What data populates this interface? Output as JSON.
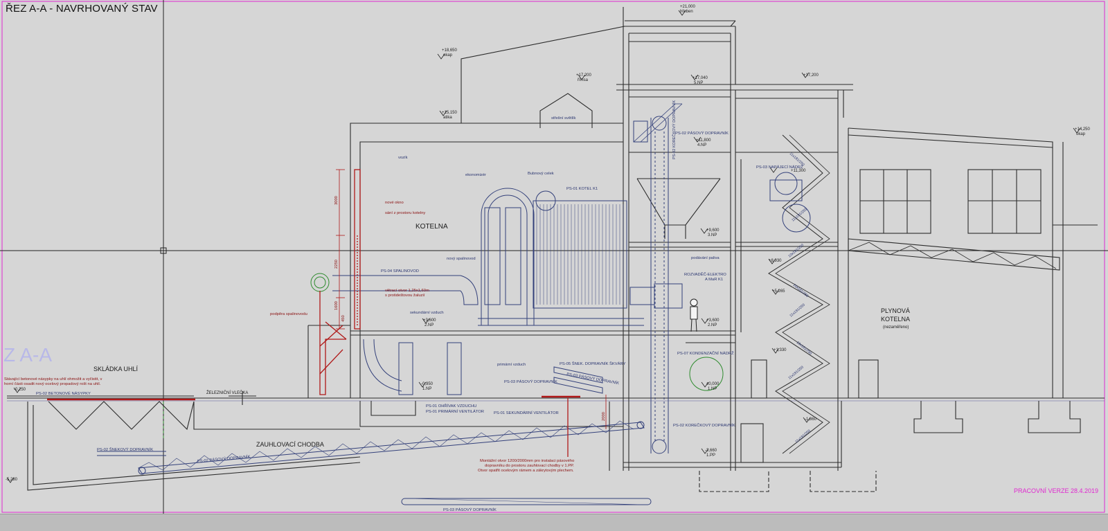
{
  "title": "ŘEZ A-A - NAVRHOVANÝ STAV",
  "version_stamp": "PRACOVNÍ VERZE    28.4.2019",
  "colors": {
    "paper": "#d6d6d6",
    "structure": "#2b2b2b",
    "equipment": "#33407a",
    "demolition_red": "#b01818",
    "green": "#2e8b2e",
    "magenta": "#e028d0"
  },
  "rooms": {
    "kotelna": "KOTELNA",
    "skladka": "SKLÁDKA UHLÍ",
    "zauhlovaci": "ZAUHLOVACÍ CHODBA",
    "plynova_1": "PLYNOVÁ",
    "plynova_2": "KOTELNA",
    "plynova_3": "(nezaměřeno)",
    "zeleznicni": "ŽELEZNIČNÍ VLEČKA",
    "ghost": "Z A-A"
  },
  "levels": {
    "l21000": "+21,000",
    "l21000_note": "hřeben",
    "l18650": "+18,650",
    "l18650_note": "okap",
    "l17200a": "+17,200",
    "l17200a_note": "římsa",
    "l17040": "+17,040",
    "l17040_note": "5.NP",
    "l17200b": "+17,200",
    "l15150": "+15,150",
    "l15150_note": "atika",
    "l14250": "+14,250",
    "l14250_note": "okap",
    "l11800": "+11,800",
    "l11800_note": "4.NP",
    "l11300": "+11,300",
    "l9600": "+9,600",
    "l9600_note": "3.NP",
    "l8930": "+8,930",
    "l5265": "+5,265",
    "l3600a": "+3,600",
    "l3600a_note": "2.NP",
    "l3600b": "+3,600",
    "l3600b_note": "2.NP",
    "l1330": "+1,330",
    "l0000": "±0,000",
    "l0000_note": "1.NP",
    "l0250": "-0,250",
    "l0950": "-0,950",
    "l0950_note": "1.NP",
    "l1860": "-1,860",
    "l3660": "-3,660",
    "l3660_note": "1.PP",
    "l5280": "-5,280"
  },
  "labels": {
    "svetlik": "střešní světlík",
    "vozik": "vozík",
    "ekonomizer": "ekonomizér",
    "bubnovy_celek": "Bubnový celek",
    "kotel": "PS-01 KOTEL K1",
    "novy_spalinovod": "nový spalinovod",
    "spalinovod": "PS-04 SPALINOVOD",
    "vetraci_otvor_1": "větrací otvor 1,25x1,60m",
    "vetraci_otvor_2": "s protideštovou žaluzií",
    "sekundarni_vzduch": "sekundární vzduch",
    "primarni_vzduch": "primární vzduch",
    "nove_okno": "nové okno",
    "sani": "sání z prostoru kotelny",
    "podpora": "podpěra spalinovodu",
    "pasovy_top": "PS-02 PÁSOVÝ DOPRAVNÍK",
    "koreckovy_vert": "PS-02 KOREČKOVÝ DOPRAVNÍK",
    "napajeci": "PS-03 NAPÁJECÍ NÁDRŽ",
    "podavani": "podávání paliva",
    "rozvadec_1": "ROZVADĚČ-ELEKTRO",
    "rozvadec_2": "A MaR K1",
    "kondenzacni": "PS-07 KONDENZAČNÍ NÁDRŽ",
    "pasovy_mid": "PS-03 PÁSOVÝ DOPRAVNÍK",
    "snek_skvary": "PS-05 ŠNEK. DOPRAVNÍK ŠKVÁRY",
    "pasovy_dopr2": "PS-03 PÁSOVÝ DOPRAVNÍK",
    "ohrivak": "PS-01 OHŘÍVAK VZDUCHU",
    "primarni_vent": "PS-01 PRIMÁRNÍ VENTILÁTOR",
    "sekundarni_vent": "PS-01 SEKUNDÁRNÍ VENTILÁTOR",
    "koreckovy_low": "PS-02 KOREČKOVÝ DOPRAVNÍK",
    "betonove": "PS-02 BETONOVÉ NÁSYPKY",
    "snekovy": "PS-02 ŠNEKOVÝ DOPRAVNÍK",
    "pasovy_ramp": "PS-02 PÁSOVÝ DOPRAVNÍK",
    "pasovy_bottom": "PS-03 PÁSOVÝ DOPRAVNÍK",
    "note_left_1": "Stávající betonové násypky na uhlí ohmožit a vyčistit, v",
    "note_left_2": "horní části osadit nový ocelový propadový rošt na uhlí.",
    "note_bottom_1": "Montážní otvor 1200/2000mm pro instalaci pásového",
    "note_bottom_2": "dopravníku do prostoru zauhlovací chodby v 1.PP.",
    "note_bottom_3": "Otvor opatřit ocelovým rámem a zákrytovým plechem.",
    "dim_3000": "3000",
    "dim_2250": "2250",
    "dim_1600": "1600",
    "dim_450": "450",
    "dim_2000": "2000",
    "stair_1": "11x181/250",
    "stair_2": "11x181/250",
    "stair_3": "10x181/250",
    "stair_4": "10x181/250",
    "stair_5": "11x181/250",
    "stair_6": "10x181/250",
    "stair_7": "11x181/250",
    "stair_8": "11x181/250"
  }
}
